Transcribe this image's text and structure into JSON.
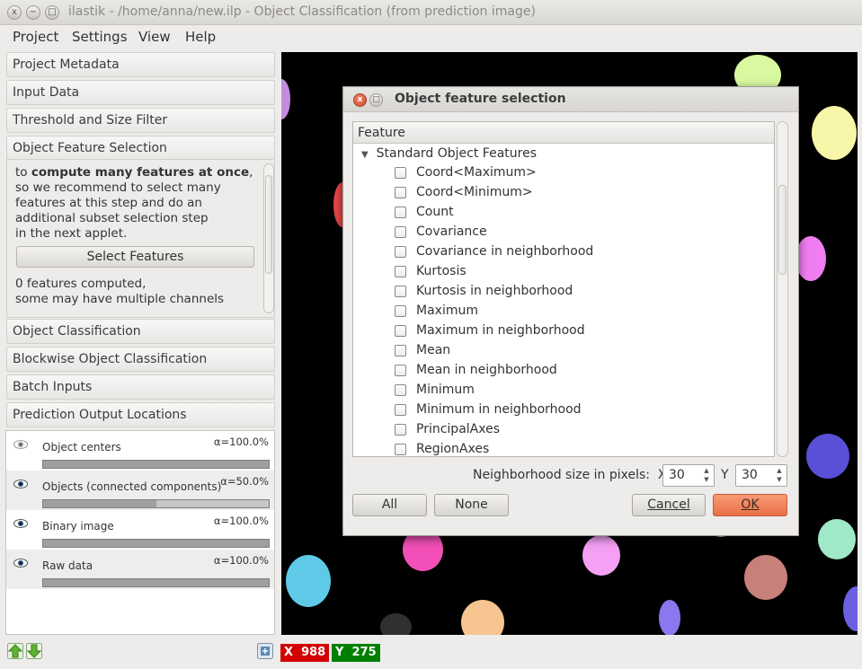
{
  "window": {
    "title": "ilastik - /home/anna/new.ilp - Object Classification (from prediction image)",
    "close_glyph": "x",
    "minimize_glyph": "−",
    "maximize_glyph": "□"
  },
  "menubar": [
    "Project",
    "Settings",
    "View",
    "Help"
  ],
  "applets": {
    "top": [
      "Project Metadata",
      "Input Data",
      "Threshold and Size Filter",
      "Object Feature Selection"
    ],
    "bottom": [
      "Object Classification",
      "Blockwise Object Classification",
      "Batch Inputs",
      "Prediction Output Locations"
    ]
  },
  "feature_drawer": {
    "line1_prefix": "to ",
    "line1_bold": "compute many features at once",
    "line1_suffix": ",",
    "line2": "so we recommend to select many",
    "line3": "features at this step and do an",
    "line4": "additional subset selection step",
    "line5": "in the next applet.",
    "button": "Select Features",
    "status1": "0 features computed,",
    "status2": "some may have multiple channels"
  },
  "layers": [
    {
      "name": "Object centers",
      "alpha": "α=100.0%",
      "opacity": 1.0,
      "visible": true
    },
    {
      "name": "Objects (connected components)",
      "alpha": "α=50.0%",
      "opacity": 0.5,
      "visible": true
    },
    {
      "name": "Binary image",
      "alpha": "α=100.0%",
      "opacity": 1.0,
      "visible": true
    },
    {
      "name": "Raw data",
      "alpha": "α=100.0%",
      "opacity": 1.0,
      "visible": true
    }
  ],
  "position": {
    "x_label": "X",
    "x_value": "988",
    "y_label": "Y",
    "y_value": "275"
  },
  "dialog": {
    "title": "Object feature selection",
    "column_header": "Feature",
    "group": "Standard Object Features",
    "features": [
      "Coord<Maximum>",
      "Coord<Minimum>",
      "Count",
      "Covariance",
      "Covariance in neighborhood",
      "Kurtosis",
      "Kurtosis in neighborhood",
      "Maximum",
      "Maximum in neighborhood",
      "Mean",
      "Mean in neighborhood",
      "Minimum",
      "Minimum in neighborhood",
      "PrincipalAxes",
      "RegionAxes"
    ],
    "neighborhood_label": "Neighborhood size in pixels:",
    "x_label": "X",
    "x_value": "30",
    "y_label": "Y",
    "y_value": "30",
    "buttons": {
      "all": "All",
      "none": "None",
      "cancel": "Cancel",
      "ok": "OK"
    }
  },
  "colors": {
    "accent_ok": "#ea6f45",
    "coord_x_bg": "#d40000",
    "coord_y_bg": "#008000",
    "viewer_bg": "#000000"
  }
}
